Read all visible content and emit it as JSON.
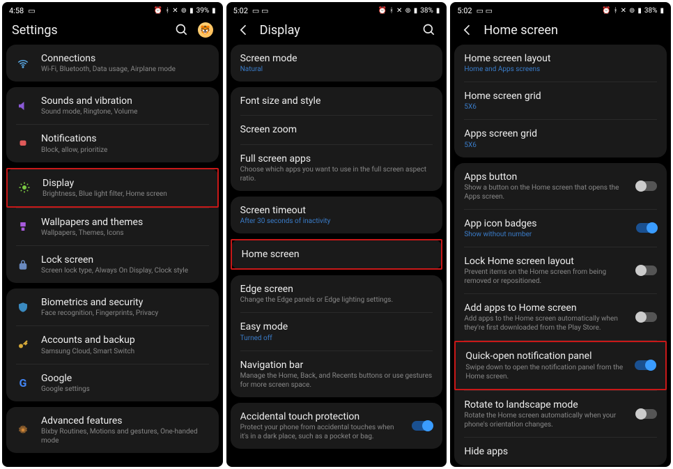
{
  "screens": [
    {
      "status": {
        "time": "4:58",
        "battery": "39%"
      },
      "header": {
        "title": "Settings",
        "back": false,
        "search": true,
        "avatar": true
      },
      "groups": [
        {
          "rows": [
            {
              "icon": "wifi",
              "iconColor": "#5aa9e6",
              "title": "Connections",
              "sub": "Wi-Fi, Bluetooth, Data usage, Airplane mode"
            }
          ]
        },
        {
          "rows": [
            {
              "icon": "sound",
              "iconColor": "#8a5ad6",
              "title": "Sounds and vibration",
              "sub": "Sound mode, Ringtone, Volume"
            },
            {
              "icon": "bell",
              "iconColor": "#e05a5a",
              "title": "Notifications",
              "sub": "Block, allow, prioritize"
            }
          ]
        },
        {
          "rows": [
            {
              "icon": "sun",
              "iconColor": "#7ac943",
              "title": "Display",
              "sub": "Brightness, Blue light filter, Home screen",
              "highlight": true
            },
            {
              "icon": "brush",
              "iconColor": "#a85add",
              "title": "Wallpapers and themes",
              "sub": "Wallpapers, Themes, Icons"
            },
            {
              "icon": "lock",
              "iconColor": "#4a7ab0",
              "title": "Lock screen",
              "sub": "Screen lock type, Always On Display, Clock style"
            }
          ]
        },
        {
          "rows": [
            {
              "icon": "shield",
              "iconColor": "#3a8ac0",
              "title": "Biometrics and security",
              "sub": "Face recognition, Fingerprints, Privacy"
            },
            {
              "icon": "key",
              "iconColor": "#d4a838",
              "title": "Accounts and backup",
              "sub": "Samsung Cloud, Smart Switch"
            },
            {
              "icon": "google",
              "iconColor": "#4285f4",
              "title": "Google",
              "sub": "Google settings"
            }
          ]
        },
        {
          "rows": [
            {
              "icon": "gear",
              "iconColor": "#d48838",
              "title": "Advanced features",
              "sub": "Bixby Routines, Motions and gestures, One-handed mode"
            }
          ]
        }
      ]
    },
    {
      "status": {
        "time": "5:02",
        "battery": "38%"
      },
      "header": {
        "title": "Display",
        "back": true,
        "search": true,
        "avatar": false
      },
      "groups": [
        {
          "rows": [
            {
              "title": "Screen mode",
              "sub": "Natural",
              "subBlue": true
            }
          ]
        },
        {
          "rows": [
            {
              "title": "Font size and style"
            },
            {
              "title": "Screen zoom"
            },
            {
              "title": "Full screen apps",
              "sub": "Choose which apps you want to use in the full screen aspect ratio."
            }
          ]
        },
        {
          "rows": [
            {
              "title": "Screen timeout",
              "sub": "After 30 seconds of inactivity",
              "subBlue": true
            }
          ]
        },
        {
          "rows": [
            {
              "title": "Home screen",
              "highlight": true
            }
          ]
        },
        {
          "rows": [
            {
              "title": "Edge screen",
              "sub": "Change the Edge panels or Edge lighting settings."
            },
            {
              "title": "Easy mode",
              "sub": "Turned off",
              "subBlue": true
            },
            {
              "title": "Navigation bar",
              "sub": "Manage the Home, Back, and Recents buttons or use gestures for more screen space."
            }
          ]
        },
        {
          "rows": [
            {
              "title": "Accidental touch protection",
              "sub": "Protect your phone from accidental touches when it's in a dark place, such as a pocket or bag.",
              "toggle": "on"
            }
          ]
        }
      ]
    },
    {
      "status": {
        "time": "5:02",
        "battery": "38%"
      },
      "header": {
        "title": "Home screen",
        "back": true,
        "search": false,
        "avatar": false
      },
      "groups": [
        {
          "rows": [
            {
              "title": "Home screen layout",
              "sub": "Home and Apps screens",
              "subBlue": true
            },
            {
              "title": "Home screen grid",
              "sub": "5X6",
              "subBlue": true
            },
            {
              "title": "Apps screen grid",
              "sub": "5X6",
              "subBlue": true
            }
          ]
        },
        {
          "rows": [
            {
              "title": "Apps button",
              "sub": "Show a button on the Home screen that opens the Apps screen.",
              "toggle": "off"
            },
            {
              "title": "App icon badges",
              "sub": "Show without number",
              "subBlue": true,
              "toggle": "on"
            },
            {
              "title": "Lock Home screen layout",
              "sub": "Prevent items on the Home screen from being removed or repositioned.",
              "toggle": "off"
            },
            {
              "title": "Add apps to Home screen",
              "sub": "Add apps to the Home screen automatically when they're first downloaded from the Play Store.",
              "toggle": "off"
            },
            {
              "title": "Quick-open notification panel",
              "sub": "Swipe down to open the notification panel from the Home screen.",
              "toggle": "on",
              "highlight": true
            },
            {
              "title": "Rotate to landscape mode",
              "sub": "Rotate the Home screen automatically when your phone's orientation changes.",
              "toggle": "off"
            },
            {
              "title": "Hide apps"
            }
          ]
        }
      ]
    }
  ]
}
